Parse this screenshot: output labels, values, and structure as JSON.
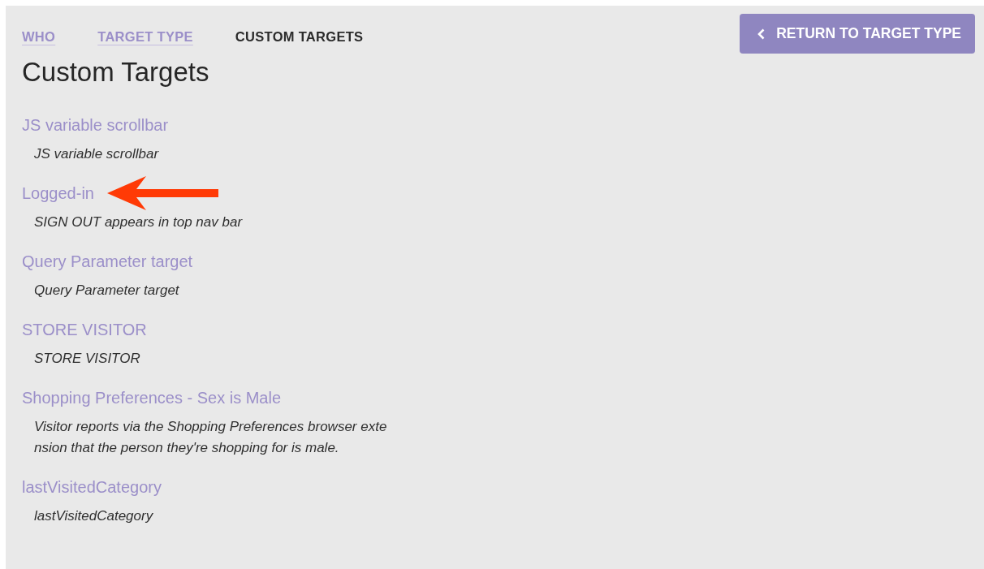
{
  "breadcrumb": [
    {
      "label": "WHO",
      "selected": false
    },
    {
      "label": "TARGET TYPE",
      "selected": false
    },
    {
      "label": "CUSTOM TARGETS",
      "selected": true
    }
  ],
  "return_button": {
    "label": "RETURN TO TARGET TYPE"
  },
  "title": "Custom Targets",
  "targets": [
    {
      "name": "JS variable scrollbar",
      "description": [
        "JS variable scrollbar"
      ],
      "annotated": false
    },
    {
      "name": "Logged-in",
      "description": [
        "SIGN OUT appears in top nav bar"
      ],
      "annotated": true
    },
    {
      "name": "Query Parameter target",
      "description": [
        "Query Parameter target"
      ],
      "annotated": false
    },
    {
      "name": "STORE VISITOR",
      "description": [
        "STORE VISITOR"
      ],
      "annotated": false
    },
    {
      "name": "Shopping Preferences - Sex is Male",
      "description": [
        "Visitor reports via the Shopping Preferences browser exte",
        "nsion that the person they're shopping for is male."
      ],
      "annotated": false
    },
    {
      "name": "lastVisitedCategory",
      "description": [
        "lastVisitedCategory"
      ],
      "annotated": false
    }
  ]
}
